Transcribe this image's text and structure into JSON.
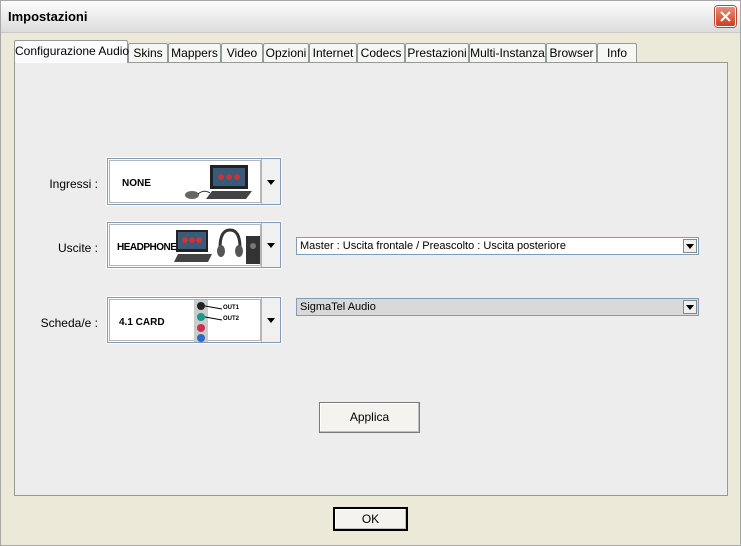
{
  "window": {
    "title": "Impostazioni"
  },
  "tabs": [
    {
      "label": "Configurazione Audio",
      "active": true
    },
    {
      "label": "Skins"
    },
    {
      "label": "Mappers"
    },
    {
      "label": "Video"
    },
    {
      "label": "Opzioni"
    },
    {
      "label": "Internet"
    },
    {
      "label": "Codecs"
    },
    {
      "label": "Prestazioni"
    },
    {
      "label": "Multi-Instanza"
    },
    {
      "label": "Browser"
    },
    {
      "label": "Info"
    }
  ],
  "audio": {
    "inputs": {
      "label": "Ingressi :",
      "value": "NONE"
    },
    "outputs": {
      "label": "Uscite :",
      "value": "HEADPHONES",
      "routing": "Master : Uscita frontale / Preascolto : Uscita posteriore"
    },
    "cards": {
      "label": "Scheda/e :",
      "value": "4.1 CARD",
      "out1": "OUT1",
      "out2": "OUT2",
      "device": "SigmaTel Audio"
    }
  },
  "buttons": {
    "apply": "Applica",
    "ok": "OK"
  }
}
